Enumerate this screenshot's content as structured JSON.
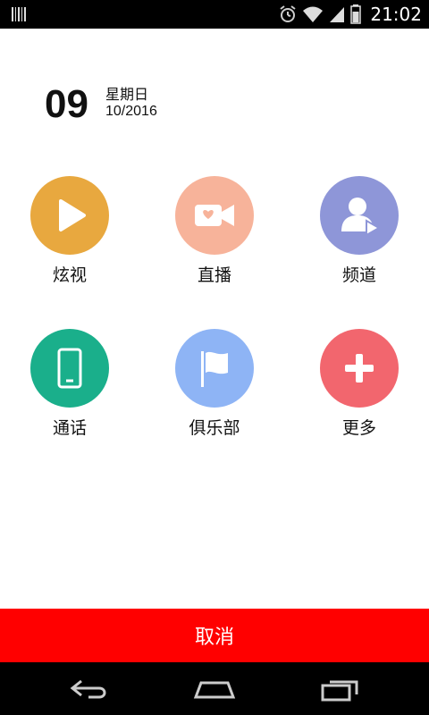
{
  "status_bar": {
    "time": "21:02",
    "icons": [
      "barcode-icon",
      "alarm-icon",
      "wifi-icon",
      "signal-icon",
      "battery-icon"
    ]
  },
  "date": {
    "day": "09",
    "weekday": "星期日",
    "month_year": "10/2016"
  },
  "grid": {
    "items": [
      {
        "label": "炫视",
        "icon": "play-icon",
        "color": "#E8A83F"
      },
      {
        "label": "直播",
        "icon": "video-camera-icon",
        "color": "#F7B39A"
      },
      {
        "label": "频道",
        "icon": "user-video-icon",
        "color": "#8E96D8"
      },
      {
        "label": "通话",
        "icon": "phone-icon",
        "color": "#1AAF8B"
      },
      {
        "label": "俱乐部",
        "icon": "flag-icon",
        "color": "#8EB4F5"
      },
      {
        "label": "更多",
        "icon": "plus-icon",
        "color": "#F2666E"
      }
    ]
  },
  "cancel_label": "取消",
  "nav": {
    "icons": [
      "back-icon",
      "home-icon",
      "recents-icon"
    ]
  }
}
